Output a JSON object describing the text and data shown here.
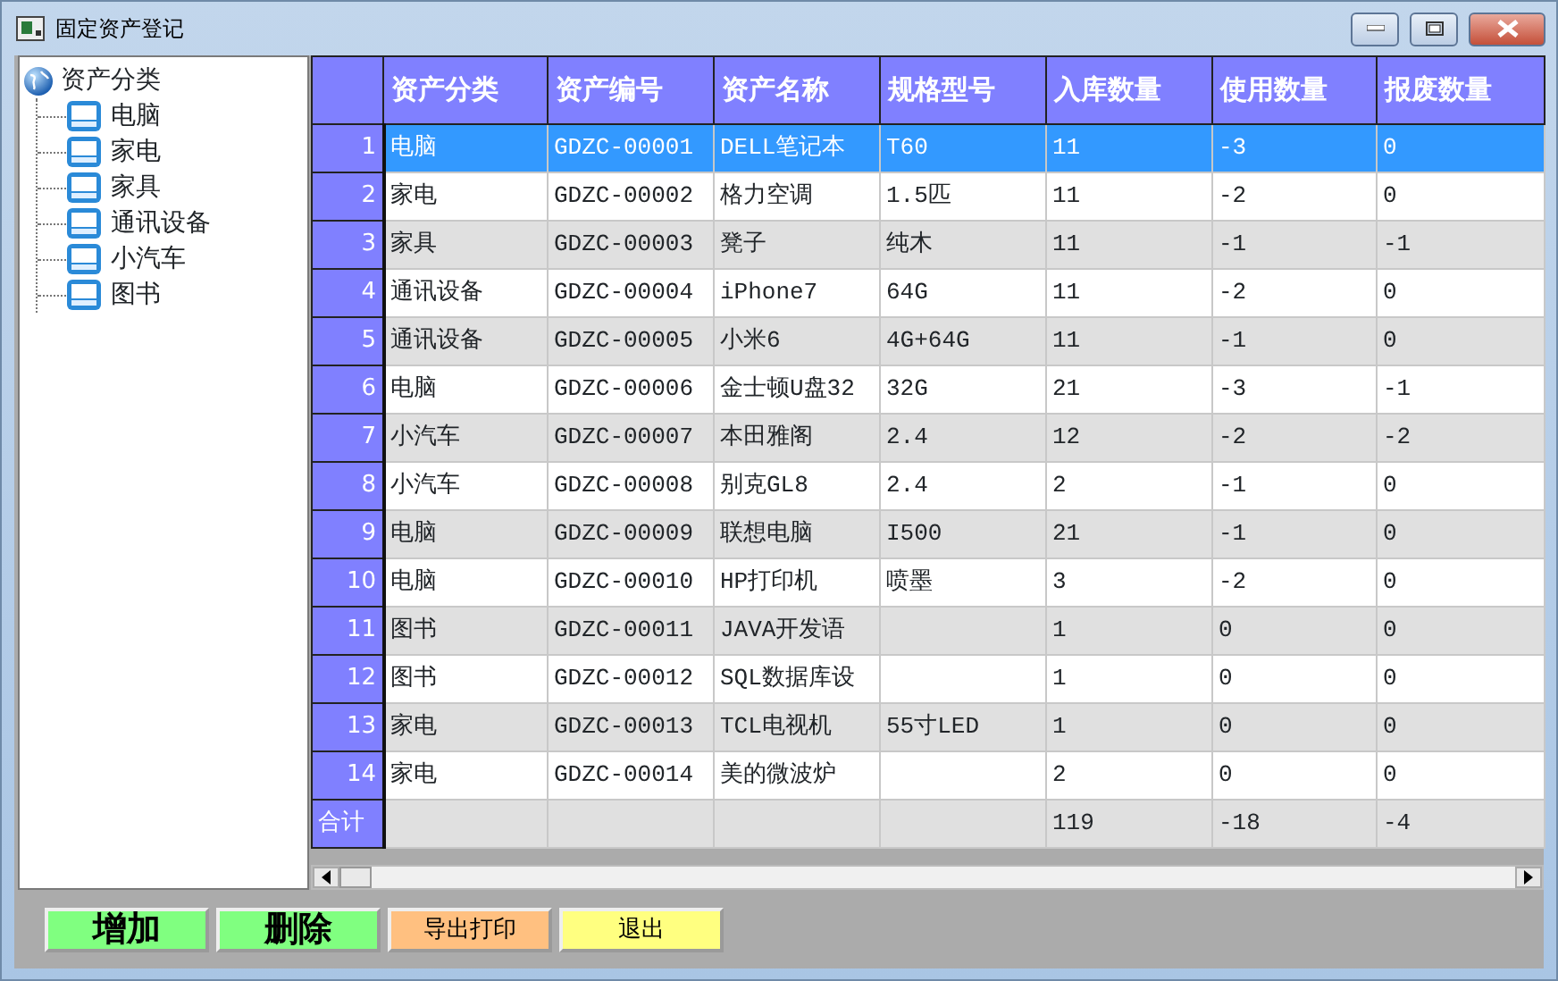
{
  "window": {
    "title": "固定资产登记"
  },
  "tree": {
    "label": "资产分类",
    "expanded": true,
    "children": [
      {
        "label": "电脑"
      },
      {
        "label": "家电"
      },
      {
        "label": "家具"
      },
      {
        "label": "通讯设备"
      },
      {
        "label": "小汽车"
      },
      {
        "label": "图书"
      }
    ]
  },
  "table": {
    "columns": [
      "资产分类",
      "资产编号",
      "资产名称",
      "规格型号",
      "入库数量",
      "使用数量",
      "报废数量"
    ],
    "rows": [
      {
        "number": "1",
        "selected": true,
        "cells": [
          "电脑",
          "GDZC-00001",
          "DELL笔记本",
          "T60",
          "11",
          "-3",
          "0"
        ]
      },
      {
        "number": "2",
        "selected": false,
        "cells": [
          "家电",
          "GDZC-00002",
          "格力空调",
          "1.5匹",
          "11",
          "-2",
          "0"
        ]
      },
      {
        "number": "3",
        "selected": false,
        "cells": [
          "家具",
          "GDZC-00003",
          "凳子",
          "纯木",
          "11",
          "-1",
          "-1"
        ]
      },
      {
        "number": "4",
        "selected": false,
        "cells": [
          "通讯设备",
          "GDZC-00004",
          "iPhone7",
          "64G",
          "11",
          "-2",
          "0"
        ]
      },
      {
        "number": "5",
        "selected": false,
        "cells": [
          "通讯设备",
          "GDZC-00005",
          "小米6",
          "4G+64G",
          "11",
          "-1",
          "0"
        ]
      },
      {
        "number": "6",
        "selected": false,
        "cells": [
          "电脑",
          "GDZC-00006",
          "金士顿U盘32",
          "32G",
          "21",
          "-3",
          "-1"
        ]
      },
      {
        "number": "7",
        "selected": false,
        "cells": [
          "小汽车",
          "GDZC-00007",
          "本田雅阁",
          "2.4",
          "12",
          "-2",
          "-2"
        ]
      },
      {
        "number": "8",
        "selected": false,
        "cells": [
          "小汽车",
          "GDZC-00008",
          "别克GL8",
          "2.4",
          "2",
          "-1",
          "0"
        ]
      },
      {
        "number": "9",
        "selected": false,
        "cells": [
          "电脑",
          "GDZC-00009",
          "联想电脑",
          "I500",
          "21",
          "-1",
          "0"
        ]
      },
      {
        "number": "10",
        "selected": false,
        "cells": [
          "电脑",
          "GDZC-00010",
          "HP打印机",
          "喷墨",
          "3",
          "-2",
          "0"
        ]
      },
      {
        "number": "11",
        "selected": false,
        "cells": [
          "图书",
          "GDZC-00011",
          "JAVA开发语",
          null,
          "1",
          "0",
          "0"
        ]
      },
      {
        "number": "12",
        "selected": false,
        "cells": [
          "图书",
          "GDZC-00012",
          "SQL数据库设",
          null,
          "1",
          "0",
          "0"
        ]
      },
      {
        "number": "13",
        "selected": false,
        "cells": [
          "家电",
          "GDZC-00013",
          "TCL电视机",
          "55寸LED",
          "1",
          "0",
          "0"
        ]
      },
      {
        "number": "14",
        "selected": false,
        "cells": [
          "家电",
          "GDZC-00014",
          "美的微波炉",
          null,
          "2",
          "0",
          "0"
        ]
      }
    ],
    "total": {
      "label": "合计",
      "cells": [
        null,
        null,
        null,
        null,
        "119",
        "-18",
        "-4"
      ]
    }
  },
  "buttons": [
    {
      "label": "增加",
      "kind": "large",
      "color": "#80ff80"
    },
    {
      "label": "删除",
      "kind": "large",
      "color": "#80ff80"
    },
    {
      "label": "导出打印",
      "kind": "normal",
      "color": "#ffc080"
    },
    {
      "label": "退出",
      "kind": "normal",
      "color": "#ffff80"
    }
  ]
}
